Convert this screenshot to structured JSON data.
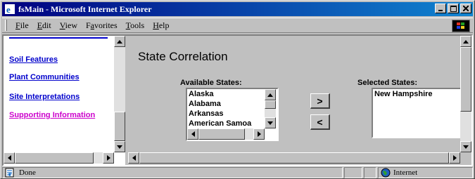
{
  "window": {
    "title": "fsMain - Microsoft Internet Explorer"
  },
  "menu": {
    "items": [
      {
        "label": "File",
        "key": "F",
        "rest": "ile"
      },
      {
        "label": "Edit",
        "key": "E",
        "rest": "dit"
      },
      {
        "label": "View",
        "key": "V",
        "rest": "iew"
      },
      {
        "label": "Favorites",
        "pre": "F",
        "key": "a",
        "rest": "vorites"
      },
      {
        "label": "Tools",
        "key": "T",
        "rest": "ools"
      },
      {
        "label": "Help",
        "key": "H",
        "rest": "elp"
      }
    ]
  },
  "nav": {
    "links": [
      {
        "label": "Soil Features",
        "visited": false
      },
      {
        "label": "Plant Communities",
        "visited": false
      },
      {
        "label": "Site Interpretations",
        "visited": false
      },
      {
        "label": "Supporting Information",
        "visited": true
      }
    ]
  },
  "main": {
    "title": "State Correlation",
    "available_label": "Available States:",
    "selected_label": "Selected States:",
    "available_states": [
      "Alaska",
      "Alabama",
      "Arkansas",
      "American Samoa"
    ],
    "selected_states": [
      "New Hampshire"
    ],
    "add_button": ">",
    "remove_button": "<"
  },
  "status": {
    "text": "Done",
    "zone": "Internet"
  },
  "colors": {
    "titlebar_start": "#000080",
    "titlebar_end": "#1084d0",
    "link": "#0000cc",
    "visited_link": "#cc00cc",
    "face": "#c0c0c0"
  },
  "icons": [
    "ie-icon",
    "minimize-icon",
    "maximize-icon",
    "close-icon",
    "windows-logo-icon",
    "page-done-icon",
    "globe-icon"
  ]
}
